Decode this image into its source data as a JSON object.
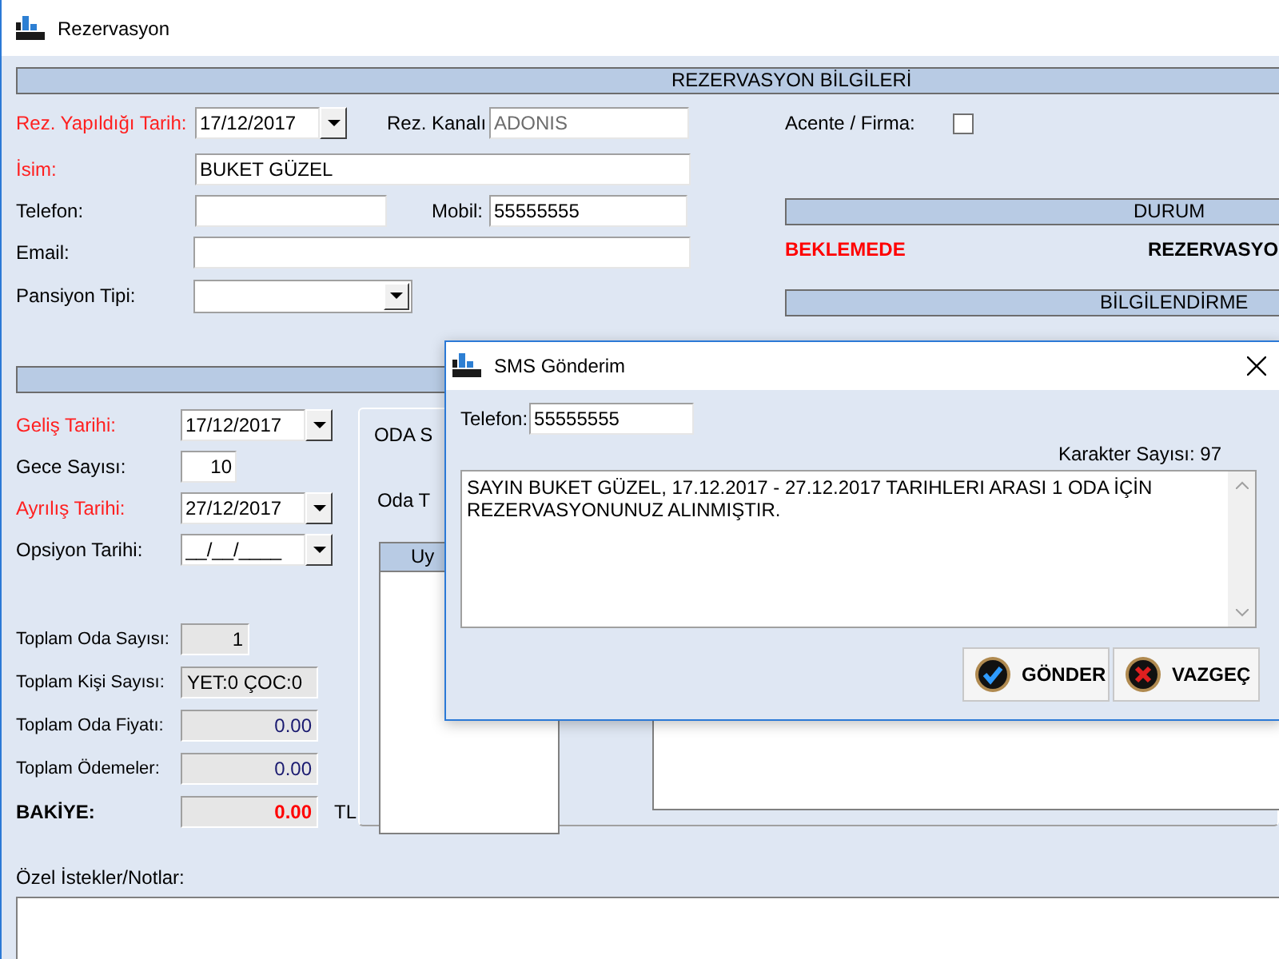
{
  "window": {
    "title": "Rezervasyon"
  },
  "reservation": {
    "header": "REZERVASYON BİLGİLERİ",
    "rez_date": {
      "label": "Rez. Yapıldığı Tarih:",
      "required": true,
      "value": "17/12/2017"
    },
    "channel": {
      "label": "Rez. Kanalı",
      "value": "ADONIS",
      "disabled": true
    },
    "name": {
      "label": "İsim:",
      "required": true,
      "value": "BUKET GÜZEL"
    },
    "phone": {
      "label": "Telefon:"
    },
    "mobile": {
      "label": "Mobil:",
      "value": "55555555"
    },
    "email": {
      "label": "Email:"
    },
    "board": {
      "label": "Pansiyon Tipi:"
    },
    "agency": {
      "label": "Acente / Firma:",
      "checked": false
    }
  },
  "status": {
    "header": "DURUM",
    "state": "BEKLEMEDE",
    "type": "REZERVASYO"
  },
  "notification": {
    "header": "BİLGİLENDİRME"
  },
  "stay": [
    {
      "label": "Geliş Tarihi:",
      "required": true,
      "value": "17/12/2017",
      "kind": "date"
    },
    {
      "label": "Gece Sayısı:",
      "required": false,
      "value": "10",
      "kind": "number"
    },
    {
      "label": "Ayrılış Tarihi:",
      "required": true,
      "value": "27/12/2017",
      "kind": "date"
    },
    {
      "label": "Opsiyon Tarihi:",
      "required": false,
      "value": "__/__/____",
      "kind": "date"
    }
  ],
  "totals": [
    {
      "label": "Toplam Oda Sayısı:",
      "value": "1",
      "kind": "short"
    },
    {
      "label": "Toplam Kişi Sayısı:",
      "value": "YET:0 ÇOC:0",
      "kind": "text"
    },
    {
      "label": "Toplam Oda Fiyatı:",
      "value": "0.00",
      "kind": "amount"
    },
    {
      "label": "Toplam Ödemeler:",
      "value": "0.00",
      "kind": "amount"
    }
  ],
  "balance": {
    "label": "BAKİYE:",
    "value": "0.00",
    "unit": "TL"
  },
  "room_panel": {
    "title": "ODA S",
    "label": "Oda T",
    "list_header": "Uy"
  },
  "notes": {
    "label": "Özel İstekler/Notlar:"
  },
  "dialog": {
    "title": "SMS Gönderim",
    "phone_label": "Telefon:",
    "phone": "55555555",
    "char_count": "Karakter Sayısı: 97",
    "message": "SAYIN BUKET GÜZEL, 17.12.2017 - 27.12.2017 TARIHLERI ARASI 1 ODA İÇİN REZERVASYONUNUZ ALINMIŞTIR.",
    "buttons": [
      {
        "label": "GÖNDER",
        "kind": "ok"
      },
      {
        "label": "VAZGEÇ",
        "kind": "cancel"
      }
    ]
  }
}
